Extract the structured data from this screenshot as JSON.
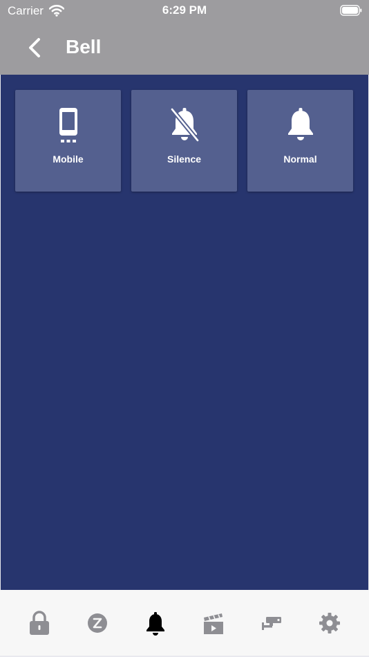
{
  "status_bar": {
    "carrier": "Carrier",
    "time": "6:29 PM"
  },
  "nav": {
    "title": "Bell",
    "back_icon": "chevron-left-icon"
  },
  "tiles": [
    {
      "label": "Mobile",
      "icon": "mobile-phone-icon"
    },
    {
      "label": "Silence",
      "icon": "bell-off-icon"
    },
    {
      "label": "Normal",
      "icon": "bell-icon"
    }
  ],
  "tab_bar": {
    "items": [
      {
        "icon": "lock-icon",
        "active": false
      },
      {
        "icon": "sleep-z-icon",
        "active": false
      },
      {
        "icon": "bell-icon",
        "active": true
      },
      {
        "icon": "clapperboard-icon",
        "active": false
      },
      {
        "icon": "security-camera-icon",
        "active": false
      },
      {
        "icon": "gear-icon",
        "active": false
      }
    ]
  },
  "colors": {
    "header_bg": "#9d9c9f",
    "main_bg": "#27356e",
    "tile_bg": "#54608f",
    "tab_bar_bg": "#f7f7f7",
    "tab_inactive": "#8e8e93",
    "tab_active": "#000000"
  }
}
